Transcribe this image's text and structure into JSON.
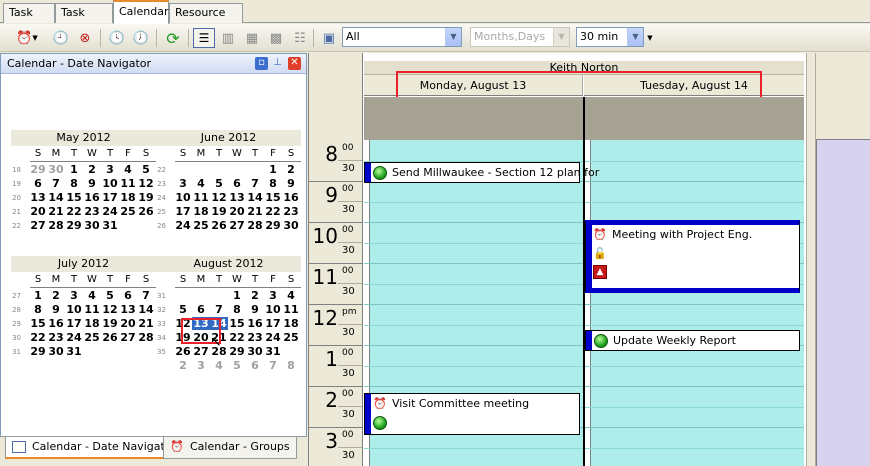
{
  "tabs": [
    {
      "label": "Task List"
    },
    {
      "label": "Task Tree"
    },
    {
      "label": "Calendar"
    },
    {
      "label": "Resource List"
    }
  ],
  "toolbar": {
    "filter_value": "All",
    "scale_value": "Months,Days",
    "interval_value": "30 min"
  },
  "navigator": {
    "title": "Calendar - Date Navigator",
    "weekdays": [
      "S",
      "M",
      "T",
      "W",
      "T",
      "F",
      "S"
    ],
    "months": [
      {
        "title": "May 2012",
        "weeks": [
          {
            "num": "18",
            "days": [
              "29",
              "30",
              "1",
              "2",
              "3",
              "4",
              "5"
            ],
            "grey": [
              0,
              1
            ]
          },
          {
            "num": "19",
            "days": [
              "6",
              "7",
              "8",
              "9",
              "10",
              "11",
              "12"
            ],
            "grey": []
          },
          {
            "num": "20",
            "days": [
              "13",
              "14",
              "15",
              "16",
              "17",
              "18",
              "19"
            ],
            "grey": []
          },
          {
            "num": "21",
            "days": [
              "20",
              "21",
              "22",
              "23",
              "24",
              "25",
              "26"
            ],
            "grey": []
          },
          {
            "num": "22",
            "days": [
              "27",
              "28",
              "29",
              "30",
              "31",
              "",
              ""
            ],
            "grey": []
          }
        ]
      },
      {
        "title": "June 2012",
        "weeks": [
          {
            "num": "22",
            "days": [
              "",
              "",
              "",
              "",
              "",
              "1",
              "2"
            ],
            "grey": []
          },
          {
            "num": "23",
            "days": [
              "3",
              "4",
              "5",
              "6",
              "7",
              "8",
              "9"
            ],
            "grey": []
          },
          {
            "num": "24",
            "days": [
              "10",
              "11",
              "12",
              "13",
              "14",
              "15",
              "16"
            ],
            "grey": []
          },
          {
            "num": "25",
            "days": [
              "17",
              "18",
              "19",
              "20",
              "21",
              "22",
              "23"
            ],
            "grey": []
          },
          {
            "num": "26",
            "days": [
              "24",
              "25",
              "26",
              "27",
              "28",
              "29",
              "30"
            ],
            "grey": []
          }
        ]
      },
      {
        "title": "July 2012",
        "weeks": [
          {
            "num": "27",
            "days": [
              "1",
              "2",
              "3",
              "4",
              "5",
              "6",
              "7"
            ],
            "grey": []
          },
          {
            "num": "28",
            "days": [
              "8",
              "9",
              "10",
              "11",
              "12",
              "13",
              "14"
            ],
            "grey": []
          },
          {
            "num": "29",
            "days": [
              "15",
              "16",
              "17",
              "18",
              "19",
              "20",
              "21"
            ],
            "grey": []
          },
          {
            "num": "30",
            "days": [
              "22",
              "23",
              "24",
              "25",
              "26",
              "27",
              "28"
            ],
            "grey": []
          },
          {
            "num": "31",
            "days": [
              "29",
              "30",
              "31",
              "",
              "",
              "",
              ""
            ],
            "grey": []
          }
        ]
      },
      {
        "title": "August 2012",
        "weeks": [
          {
            "num": "31",
            "days": [
              "",
              "",
              "",
              "1",
              "2",
              "3",
              "4"
            ],
            "grey": []
          },
          {
            "num": "32",
            "days": [
              "5",
              "6",
              "7",
              "8",
              "9",
              "10",
              "11"
            ],
            "grey": []
          },
          {
            "num": "33",
            "days": [
              "12",
              "13",
              "14",
              "15",
              "16",
              "17",
              "18"
            ],
            "grey": [],
            "sel": [
              1,
              2
            ]
          },
          {
            "num": "34",
            "days": [
              "19",
              "20",
              "21",
              "22",
              "23",
              "24",
              "25"
            ],
            "grey": []
          },
          {
            "num": "35",
            "days": [
              "26",
              "27",
              "28",
              "29",
              "30",
              "31",
              ""
            ],
            "grey": []
          },
          {
            "num": "",
            "days": [
              "",
              "2",
              "3",
              "4",
              "5",
              "6",
              "7",
              "8"
            ],
            "grey": [
              1,
              2,
              3,
              4,
              5,
              6,
              7
            ]
          }
        ]
      }
    ],
    "bottom_tabs": [
      {
        "label": "Calendar - Date Navigator"
      },
      {
        "label": "Calendar - Groups"
      }
    ]
  },
  "scheduler": {
    "resource": "Keith Norton",
    "days": [
      "Monday, August 13",
      "Tuesday, August 14"
    ],
    "hours": [
      {
        "h": "8",
        "m": "00"
      },
      {
        "h": "9",
        "m": "00"
      },
      {
        "h": "10",
        "m": "00"
      },
      {
        "h": "11",
        "m": "00"
      },
      {
        "h": "12",
        "m": "pm"
      },
      {
        "h": "1",
        "m": "00"
      },
      {
        "h": "2",
        "m": "00"
      },
      {
        "h": "3",
        "m": "00"
      }
    ],
    "half_label": "30",
    "appointments": [
      {
        "subject": "Send Millwaukee - Section 12 plan for"
      },
      {
        "subject": "Meeting with Project Eng."
      },
      {
        "subject": "Update Weekly Report"
      },
      {
        "subject": "Visit Committee meeting"
      }
    ]
  },
  "colors": {
    "day_bg": "#aeeeea",
    "appt_bar": "#0000c8",
    "highlight": "#e8212b",
    "other_resource_bg": "#d7d2ee"
  }
}
